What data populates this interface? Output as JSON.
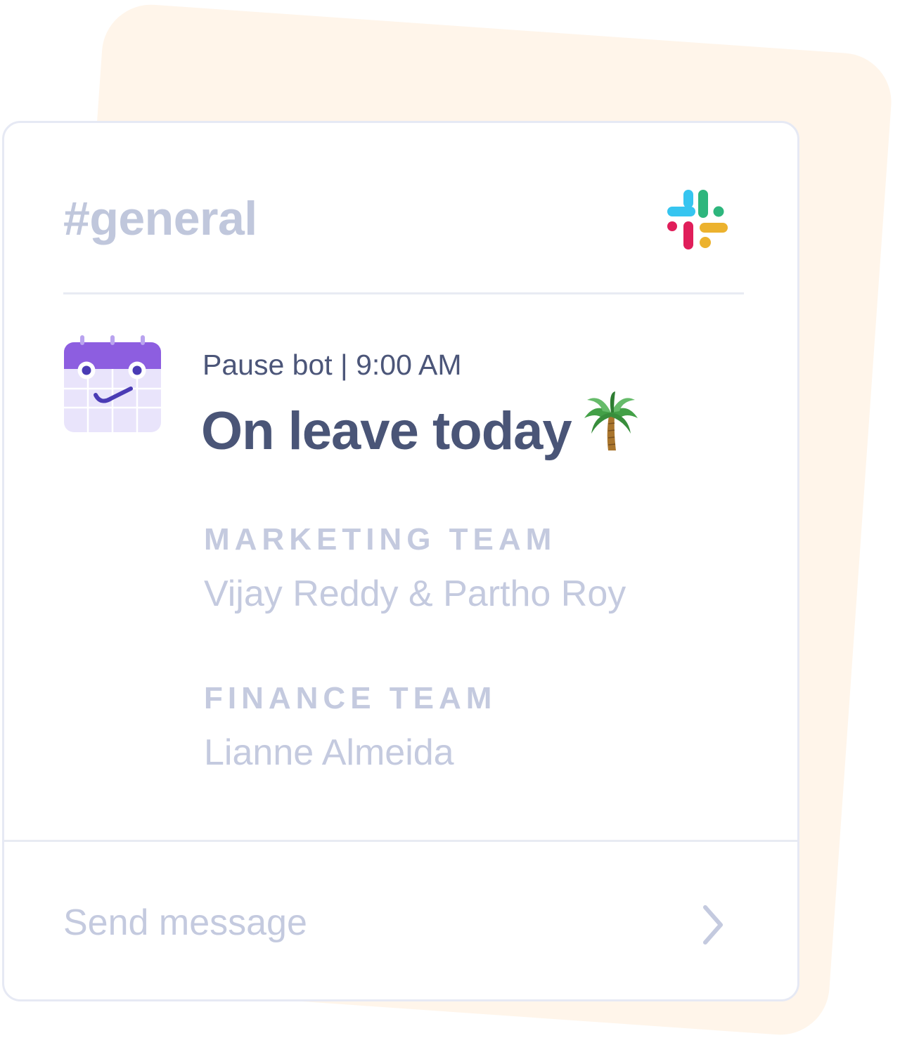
{
  "channel": {
    "name": "#general"
  },
  "message": {
    "meta": "Pause bot | 9:00 AM",
    "headline": "On leave today"
  },
  "teams": [
    {
      "label": "MARKETING TEAM",
      "members": "Vijay Reddy & Partho Roy"
    },
    {
      "label": "FINANCE TEAM",
      "members": "Lianne Almeida"
    }
  ],
  "composer": {
    "placeholder": "Send message"
  },
  "icons": {
    "brand_logo": "slack-logo-icon",
    "bot_avatar": "calendar-face-icon",
    "headline_emoji": "palm-tree-icon",
    "send": "chevron-right-icon"
  },
  "colors": {
    "back_card": "#fff5ea",
    "card_border": "#e6e9f4",
    "muted_text": "#c4cadf",
    "primary_text": "#4a5577",
    "avatar_purple": "#8d5ee0",
    "slack_blue": "#36c5f0",
    "slack_green": "#2eb67d",
    "slack_red": "#e01e5a",
    "slack_yellow": "#ecb22e"
  }
}
